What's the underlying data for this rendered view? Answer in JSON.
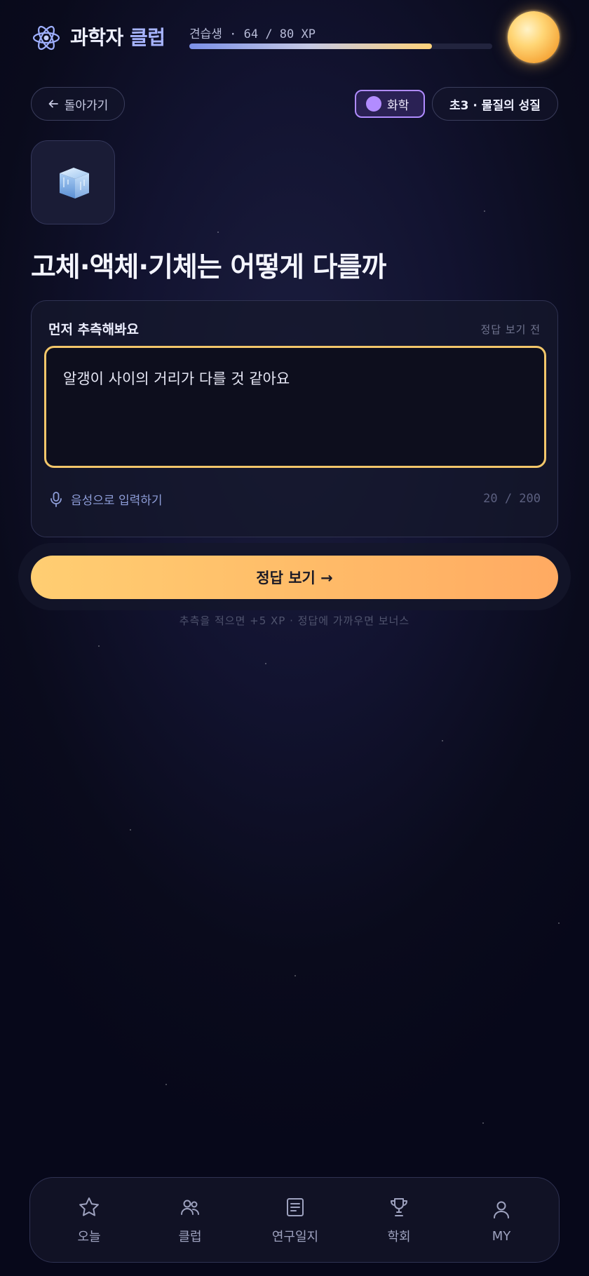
{
  "header": {
    "title_main": "과학자",
    "title_accent": "클럽",
    "rank": "견습생 · 64 / 80 XP",
    "xp_current": 64,
    "xp_max": 80
  },
  "nav": {
    "back_label": "돌아가기",
    "subject": "화학",
    "unit": "초3 · 물질의 성질"
  },
  "topic": {
    "icon": "ice-cube-icon",
    "title": "고체·액체·기체는 어떻게 다를까"
  },
  "guess_card": {
    "label": "먼저 추측해봐요",
    "state": "정답 보기 전",
    "guess_text": "알갱이 사이의 거리가 다를 것 같아요",
    "voice_label": "음성으로 입력하기",
    "counter": "20 / 200"
  },
  "submit": {
    "label": "정답 보기 →",
    "hint": "추측을 적으면 +5 XP · 정답에 가까우면 보너스"
  },
  "bottom_nav": [
    {
      "label": "오늘",
      "icon": "star-icon"
    },
    {
      "label": "클럽",
      "icon": "users-icon"
    },
    {
      "label": "연구일지",
      "icon": "notebook-icon"
    },
    {
      "label": "학회",
      "icon": "trophy-icon"
    },
    {
      "label": "MY",
      "icon": "user-icon"
    }
  ],
  "colors": {
    "accent": "#f2c66a",
    "subject": "#b08cff",
    "button": "#ffbb68"
  }
}
